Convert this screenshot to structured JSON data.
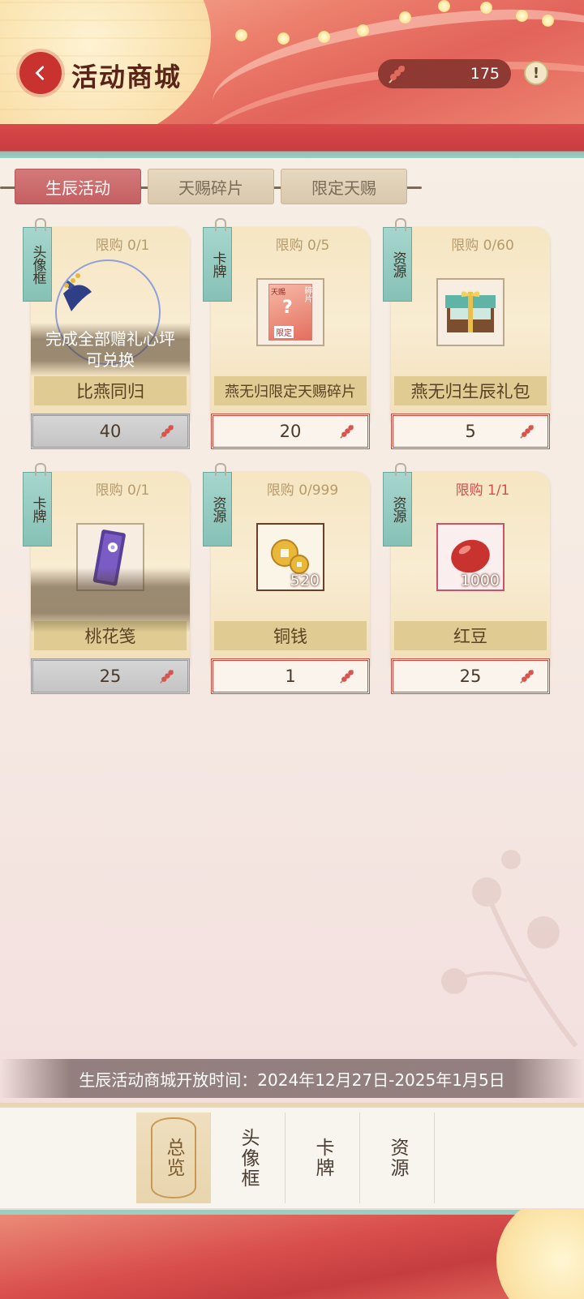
{
  "header": {
    "title": "活动商城",
    "currency_amount": "175",
    "info_label": "!"
  },
  "tabs": [
    {
      "label": "生辰活动",
      "active": true
    },
    {
      "label": "天赐碎片",
      "active": false
    },
    {
      "label": "限定天赐",
      "active": false
    }
  ],
  "items": [
    {
      "tag": "头像框",
      "limit": "限购 0/1",
      "name": "比燕同归",
      "overlay": "完成全部赠礼心坪\n可兑换",
      "price": "40",
      "locked": true,
      "icon": "swallow-avatar-frame-icon"
    },
    {
      "tag": "卡牌",
      "limit": "限购 0/5",
      "name": "燕无归限定天赐碎片",
      "price": "20",
      "locked": false,
      "icon": "limited-fragment-card-icon",
      "thumb_labels": {
        "top": "天赐",
        "side": "碎片",
        "bottom": "限定",
        "mark": "?"
      }
    },
    {
      "tag": "资源",
      "limit": "限购 0/60",
      "name": "燕无归生辰礼包",
      "price": "5",
      "locked": false,
      "icon": "gift-box-icon"
    },
    {
      "tag": "卡牌",
      "limit": "限购 0/1",
      "name": "桃花笺",
      "price": "25",
      "locked": true,
      "icon": "peach-blossom-letter-icon"
    },
    {
      "tag": "资源",
      "limit": "限购 0/999",
      "name": "铜钱",
      "price": "1",
      "locked": false,
      "icon": "copper-coins-icon",
      "qty": "520"
    },
    {
      "tag": "资源",
      "limit": "限购 1/1",
      "limit_red": true,
      "name": "红豆",
      "price": "25",
      "locked": false,
      "icon": "red-bean-icon",
      "qty": "1000"
    }
  ],
  "notice": "生辰活动商城开放时间：2024年12月27日-2025年1月5日",
  "nav": [
    {
      "label": "总览",
      "active": true
    },
    {
      "label": "头像框",
      "active": false
    },
    {
      "label": "卡牌",
      "active": false
    },
    {
      "label": "资源",
      "active": false
    }
  ],
  "colors": {
    "accent_red": "#c8322f",
    "tab_active": "#c46061",
    "tag_teal": "#86c1b6",
    "price_border": "#cf4b3f",
    "limit_red": "#d84b4b"
  }
}
